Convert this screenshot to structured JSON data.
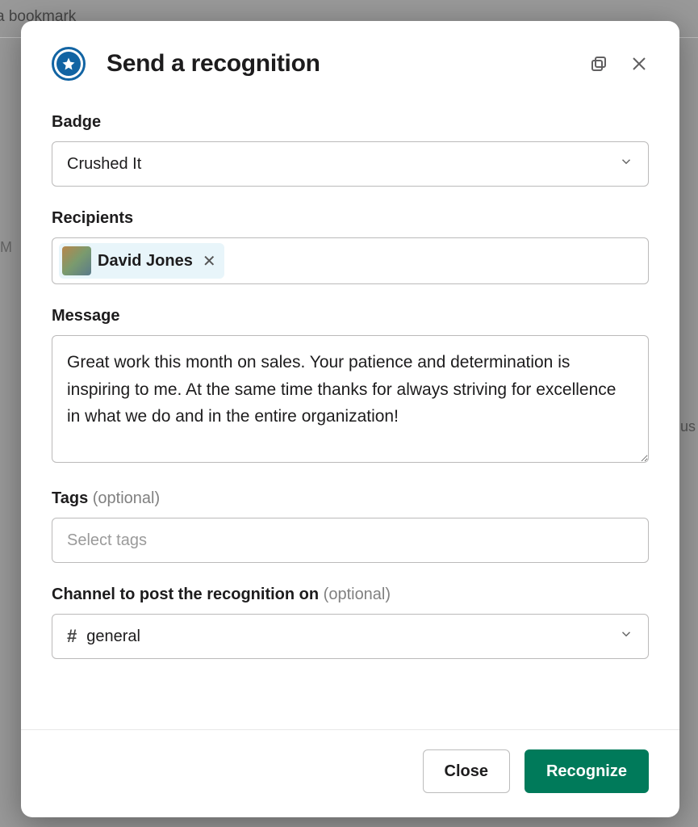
{
  "background": {
    "bookmark_fragment": "a bookmark",
    "m_fragment": "M",
    "us_fragment": "us"
  },
  "modal": {
    "title": "Send a recognition",
    "badge": {
      "label": "Badge",
      "value": "Crushed It"
    },
    "recipients": {
      "label": "Recipients",
      "chips": [
        {
          "name": "David Jones"
        }
      ]
    },
    "message": {
      "label": "Message",
      "value": "Great work this month on sales. Your patience and determination is inspiring to me. At the same time thanks for always striving for excellence in what we do and in the entire organization!"
    },
    "tags": {
      "label": "Tags",
      "optional": "(optional)",
      "placeholder": "Select tags"
    },
    "channel": {
      "label": "Channel to post the recognition on",
      "optional": "(optional)",
      "value": "general"
    },
    "footer": {
      "close": "Close",
      "recognize": "Recognize"
    }
  }
}
